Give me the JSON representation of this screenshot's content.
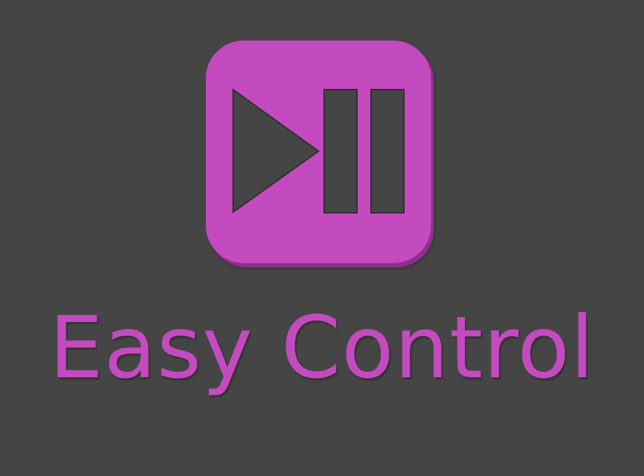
{
  "brand": {
    "title": "Easy Control",
    "accent_color": "#c44ac0",
    "shadow_color": "#8c2f8a",
    "background_color": "#454545",
    "icon": "play-pause-icon"
  }
}
